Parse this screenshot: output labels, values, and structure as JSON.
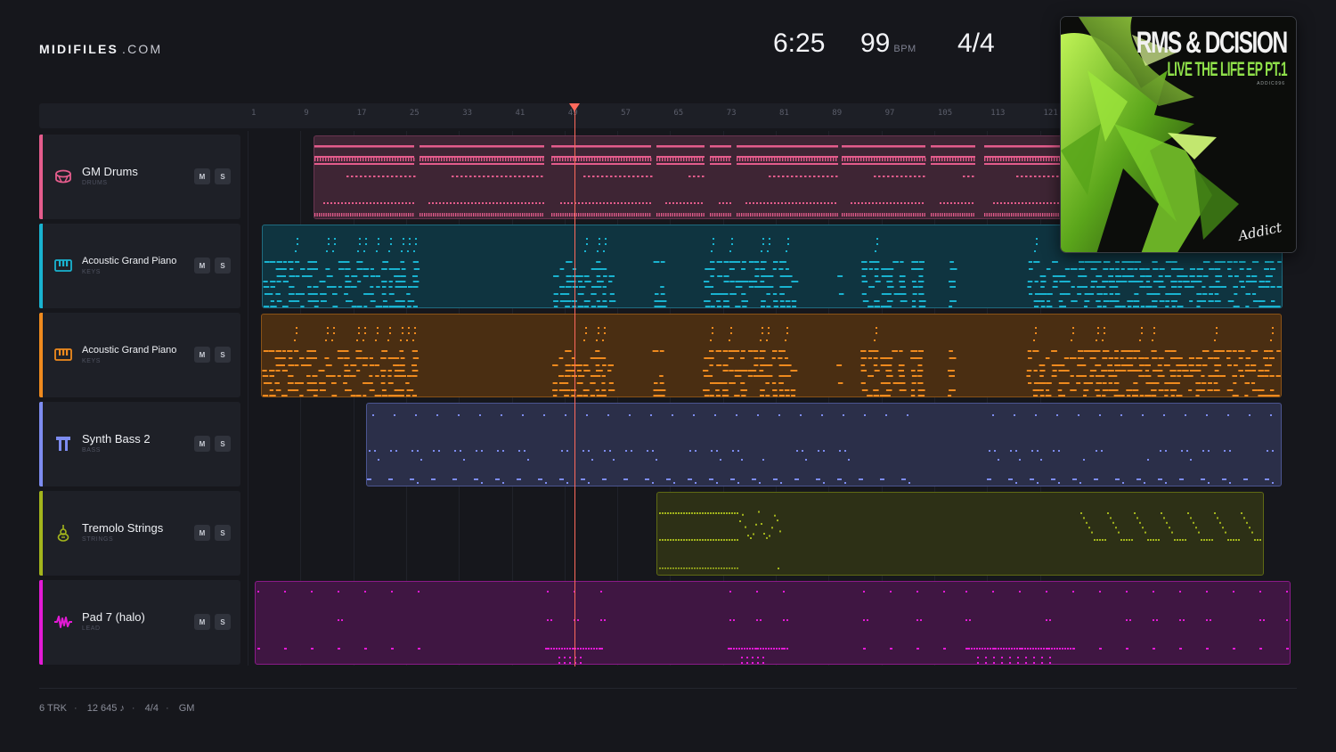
{
  "brand": {
    "name": "MIDIFILES",
    "domain": ".COM"
  },
  "transport": {
    "time": "6:25",
    "bpm": "99",
    "bpm_unit": "BPM",
    "signature": "4/4"
  },
  "ruler": {
    "ticks": [
      "1",
      "9",
      "17",
      "25",
      "33",
      "41",
      "49",
      "57",
      "65",
      "73",
      "81",
      "89",
      "97",
      "105",
      "113",
      "121"
    ]
  },
  "playhead": {
    "bar": 49
  },
  "tracks": [
    {
      "name": "GM Drums",
      "category": "DRUMS",
      "color": "#e45c8c",
      "icon": "drum-icon",
      "mute": "M",
      "solo": "S"
    },
    {
      "name": "Acoustic Grand Piano",
      "category": "KEYS",
      "color": "#19b3d0",
      "icon": "piano-icon",
      "mute": "M",
      "solo": "S"
    },
    {
      "name": "Acoustic Grand Piano",
      "category": "KEYS",
      "color": "#ef8a1e",
      "icon": "piano-icon",
      "mute": "M",
      "solo": "S"
    },
    {
      "name": "Synth Bass 2",
      "category": "BASS",
      "color": "#7d8cf0",
      "icon": "bass-icon",
      "mute": "M",
      "solo": "S"
    },
    {
      "name": "Tremolo Strings",
      "category": "STRINGS",
      "color": "#a3b51c",
      "icon": "strings-icon",
      "mute": "M",
      "solo": "S"
    },
    {
      "name": "Pad 7 (halo)",
      "category": "LEAD",
      "color": "#e31ad5",
      "icon": "lead-wave-icon",
      "mute": "M",
      "solo": "S"
    }
  ],
  "album": {
    "artist": "RMS & DCISION",
    "title": "LIVE THE LIFE EP PT.1",
    "catalog": "ADDIC096",
    "label": "Addict"
  },
  "footer": {
    "tracks": "6 TRK",
    "notes": "12 645 ♪",
    "signature": "4/4",
    "standard": "GM"
  }
}
